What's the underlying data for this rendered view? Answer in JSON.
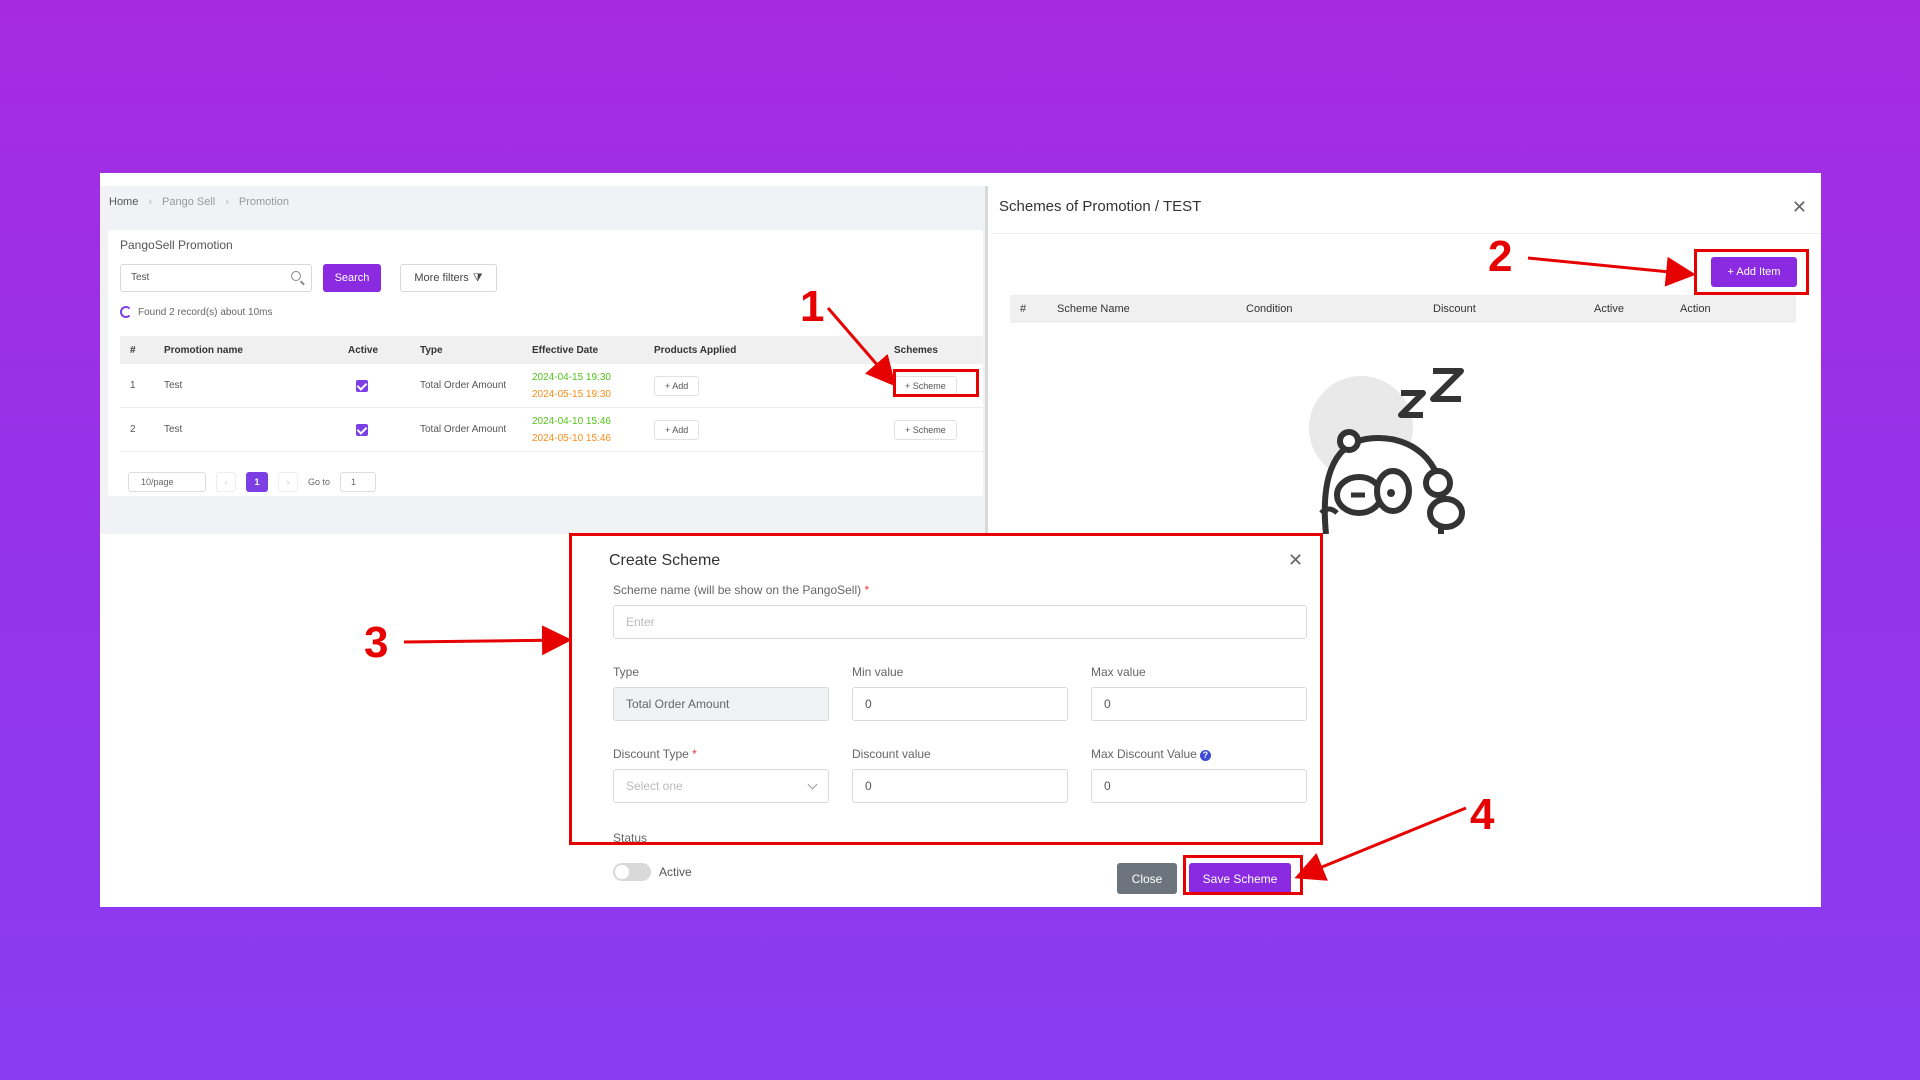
{
  "breadcrumb": [
    "Home",
    "Pango Sell",
    "Promotion"
  ],
  "list": {
    "title": "PangoSell Promotion",
    "search_value": "Test",
    "search_button": "Search",
    "filters_button": "More filters",
    "found_text": "Found 2 record(s) about 10ms",
    "columns": [
      "#",
      "Promotion name",
      "Active",
      "Type",
      "Effective Date",
      "Products Applied",
      "Schemes"
    ],
    "rows": [
      {
        "num": "1",
        "name": "Test",
        "type": "Total Order Amount",
        "date_start": "2024-04-15 19:30",
        "date_end": "2024-05-15 19:30",
        "products": "+ Add",
        "schemes": "+ Scheme"
      },
      {
        "num": "2",
        "name": "Test",
        "type": "Total Order Amount",
        "date_start": "2024-04-10 15:46",
        "date_end": "2024-05-10 15:46",
        "products": "+ Add",
        "schemes": "+ Scheme"
      }
    ],
    "pager": {
      "size": "10/page",
      "current": "1",
      "goto_label": "Go to",
      "goto_value": "1"
    }
  },
  "drawer": {
    "title": "Schemes of Promotion / TEST",
    "add_button": "+ Add Item",
    "columns": [
      "#",
      "Scheme Name",
      "Condition",
      "Discount",
      "Active",
      "Action"
    ]
  },
  "modal": {
    "title": "Create Scheme",
    "name_label": "Scheme name (will be show on the PangoSell)",
    "name_placeholder": "Enter",
    "type_label": "Type",
    "type_value": "Total Order Amount",
    "min_label": "Min value",
    "min_value": "0",
    "max_label": "Max value",
    "max_value": "0",
    "discount_type_label": "Discount Type",
    "discount_type_placeholder": "Select one",
    "discount_value_label": "Discount value",
    "discount_value": "0",
    "max_discount_label": "Max Discount Value",
    "max_discount_value": "0",
    "status_label": "Status",
    "active_label": "Active",
    "close_button": "Close",
    "save_button": "Save Scheme"
  },
  "annotations": {
    "n1": "1",
    "n2": "2",
    "n3": "3",
    "n4": "4"
  },
  "colors": {
    "accent": "#8a2be2",
    "annotation": "#e60000",
    "background": "#9b30e6"
  }
}
